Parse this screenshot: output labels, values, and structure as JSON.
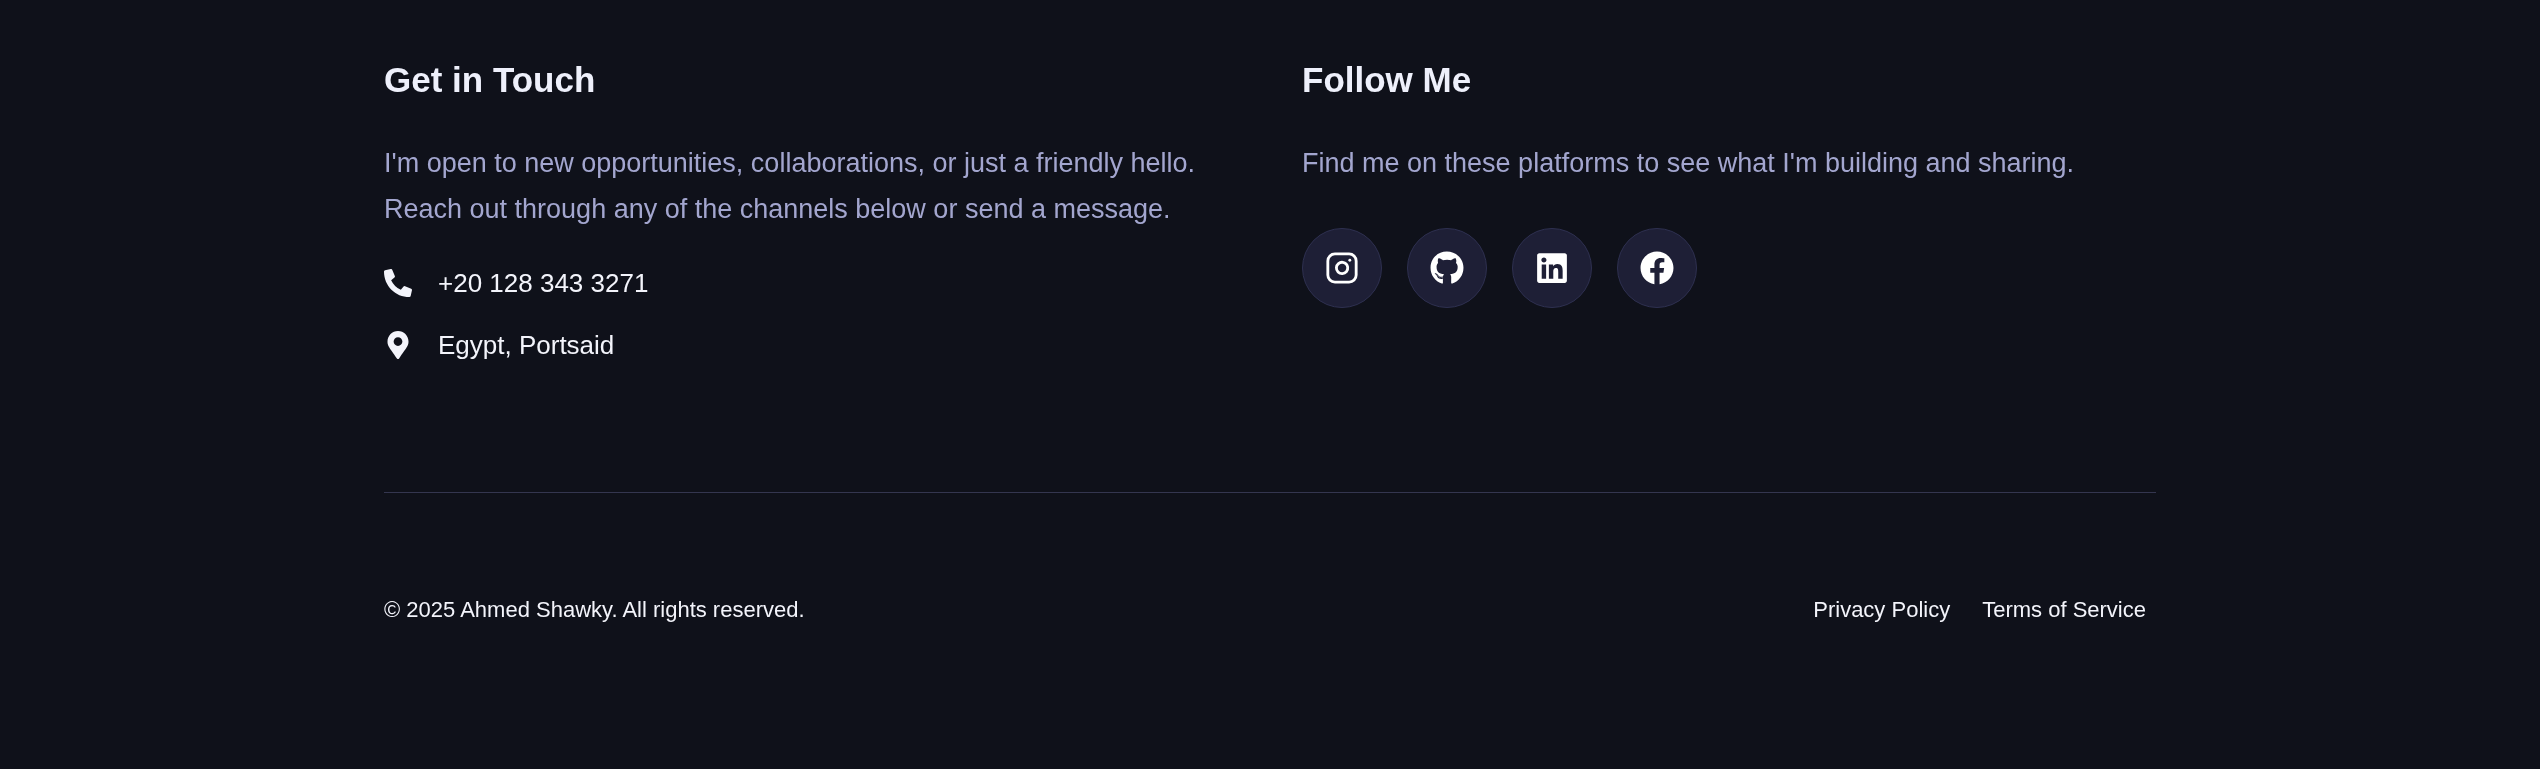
{
  "contact": {
    "title": "Get in Touch",
    "text": "I'm open to new opportunities, collaborations, or just a friendly hello. Reach out through any of the channels below or send a message.",
    "items": [
      {
        "kind": "phone",
        "text": "+20 128 343 3271"
      },
      {
        "kind": "location",
        "text": "Egypt, Portsaid"
      }
    ]
  },
  "social": {
    "title": "Follow Me",
    "text": "Find me on these platforms to see what I'm building and sharing.",
    "links": [
      {
        "kind": "instagram"
      },
      {
        "kind": "github"
      },
      {
        "kind": "linkedin"
      },
      {
        "kind": "facebook"
      }
    ]
  },
  "footer": {
    "copyright": "© 2025 Ahmed Shawky. All rights reserved.",
    "links": [
      "Privacy Policy",
      "Terms of Service"
    ]
  }
}
